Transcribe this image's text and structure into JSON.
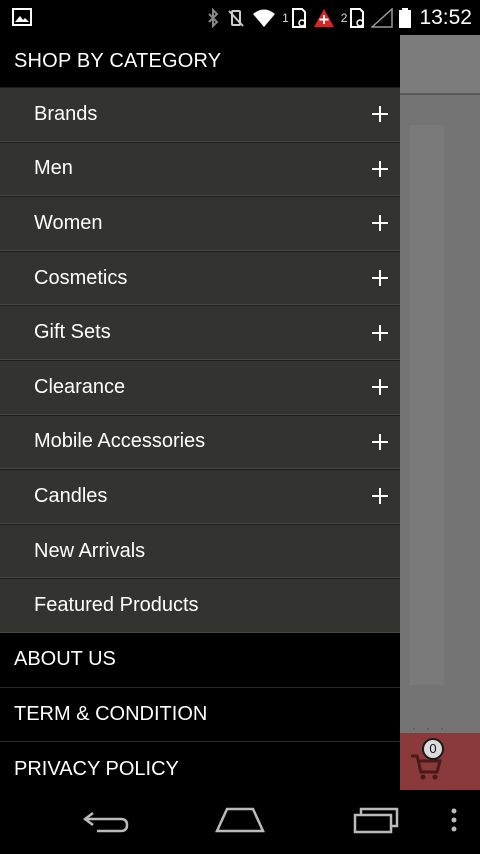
{
  "status_bar": {
    "time": "13:52",
    "sim1_label": "1",
    "sim2_label": "2",
    "icons": [
      "image-notification-icon",
      "bluetooth-icon",
      "vibrate-off-icon",
      "wifi-icon",
      "sim-signal-icon",
      "alert-icon",
      "battery-icon"
    ]
  },
  "drawer": {
    "header": "SHOP BY CATEGORY",
    "categories": [
      {
        "label": "Brands",
        "expandable": true
      },
      {
        "label": "Men",
        "expandable": true
      },
      {
        "label": "Women",
        "expandable": true
      },
      {
        "label": "Cosmetics",
        "expandable": true
      },
      {
        "label": "Gift Sets",
        "expandable": true
      },
      {
        "label": "Clearance",
        "expandable": true
      },
      {
        "label": "Mobile Accessories",
        "expandable": true
      },
      {
        "label": "Candles",
        "expandable": true
      },
      {
        "label": "New Arrivals",
        "expandable": false
      },
      {
        "label": "Featured Products",
        "expandable": false
      }
    ],
    "links": [
      {
        "label": "ABOUT US"
      },
      {
        "label": "TERM & CONDITION"
      },
      {
        "label": "PRIVACY POLICY"
      }
    ]
  },
  "background_app": {
    "cart_count": "0"
  },
  "colors": {
    "drawer_bg": "#000000",
    "category_bg": "#333330",
    "overlay": "#747474",
    "cart_button": "#8a3a3a"
  }
}
